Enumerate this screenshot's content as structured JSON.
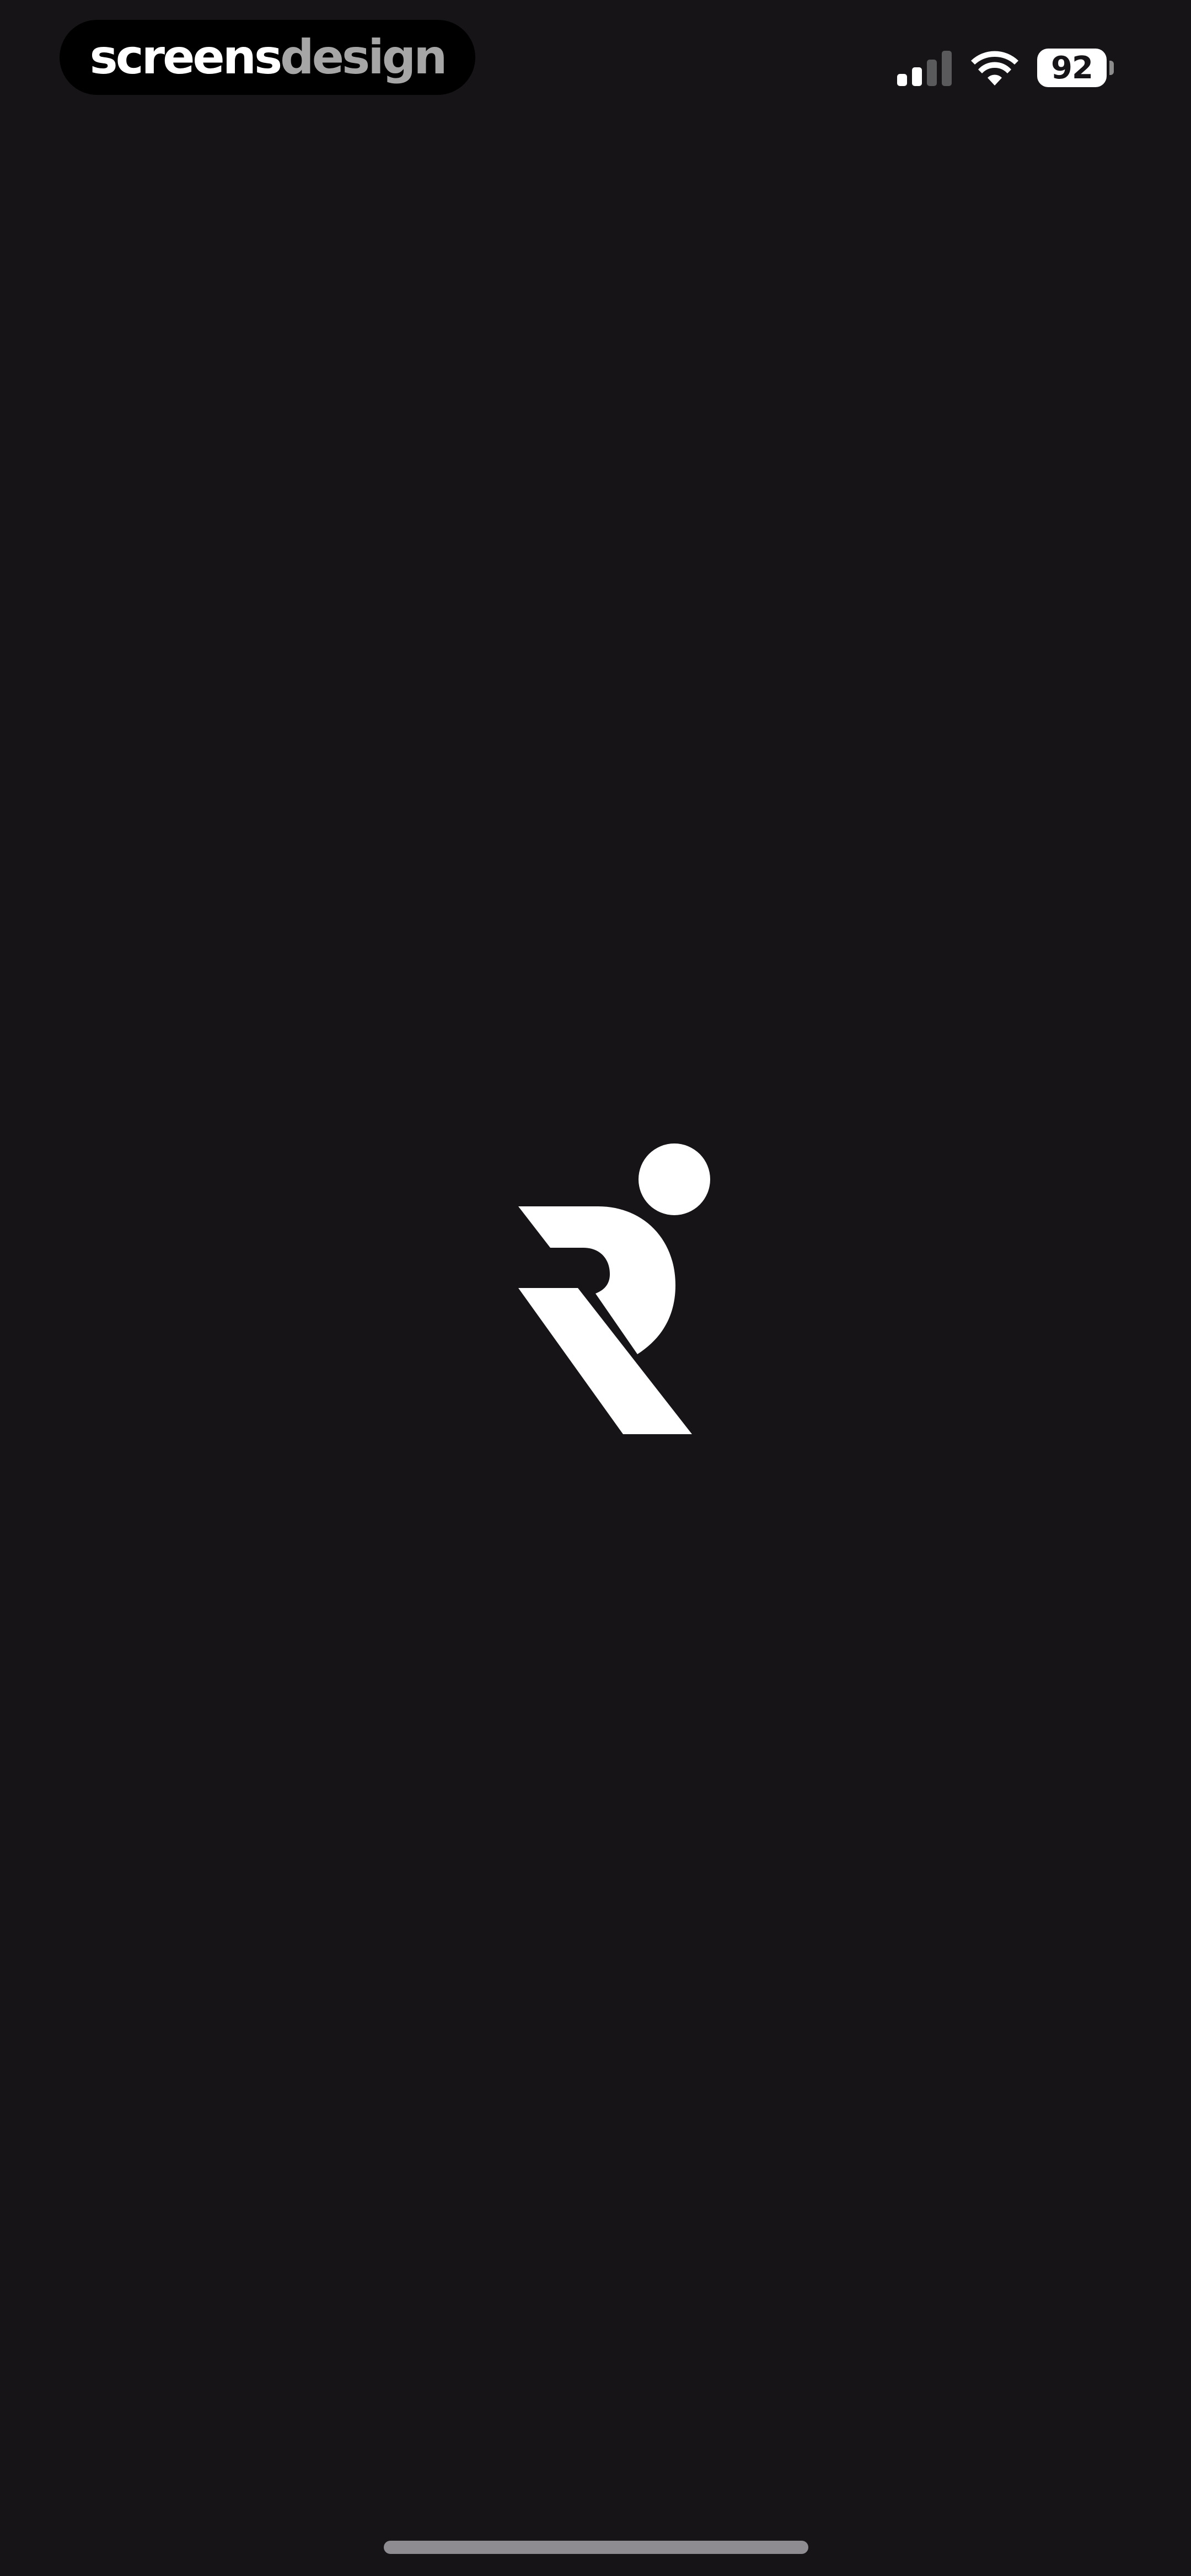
{
  "watermark": {
    "part1": "screens",
    "part2": "design"
  },
  "status_bar": {
    "battery_level": "92",
    "signal_bars_active": 2,
    "signal_bars_total": 4,
    "wifi_icon": "wifi-icon",
    "signal_icon": "cellular-signal-icon"
  },
  "splash": {
    "logo_icon": "r-runner-logo-icon",
    "background_color": "#161417",
    "logo_color": "#ffffff"
  }
}
